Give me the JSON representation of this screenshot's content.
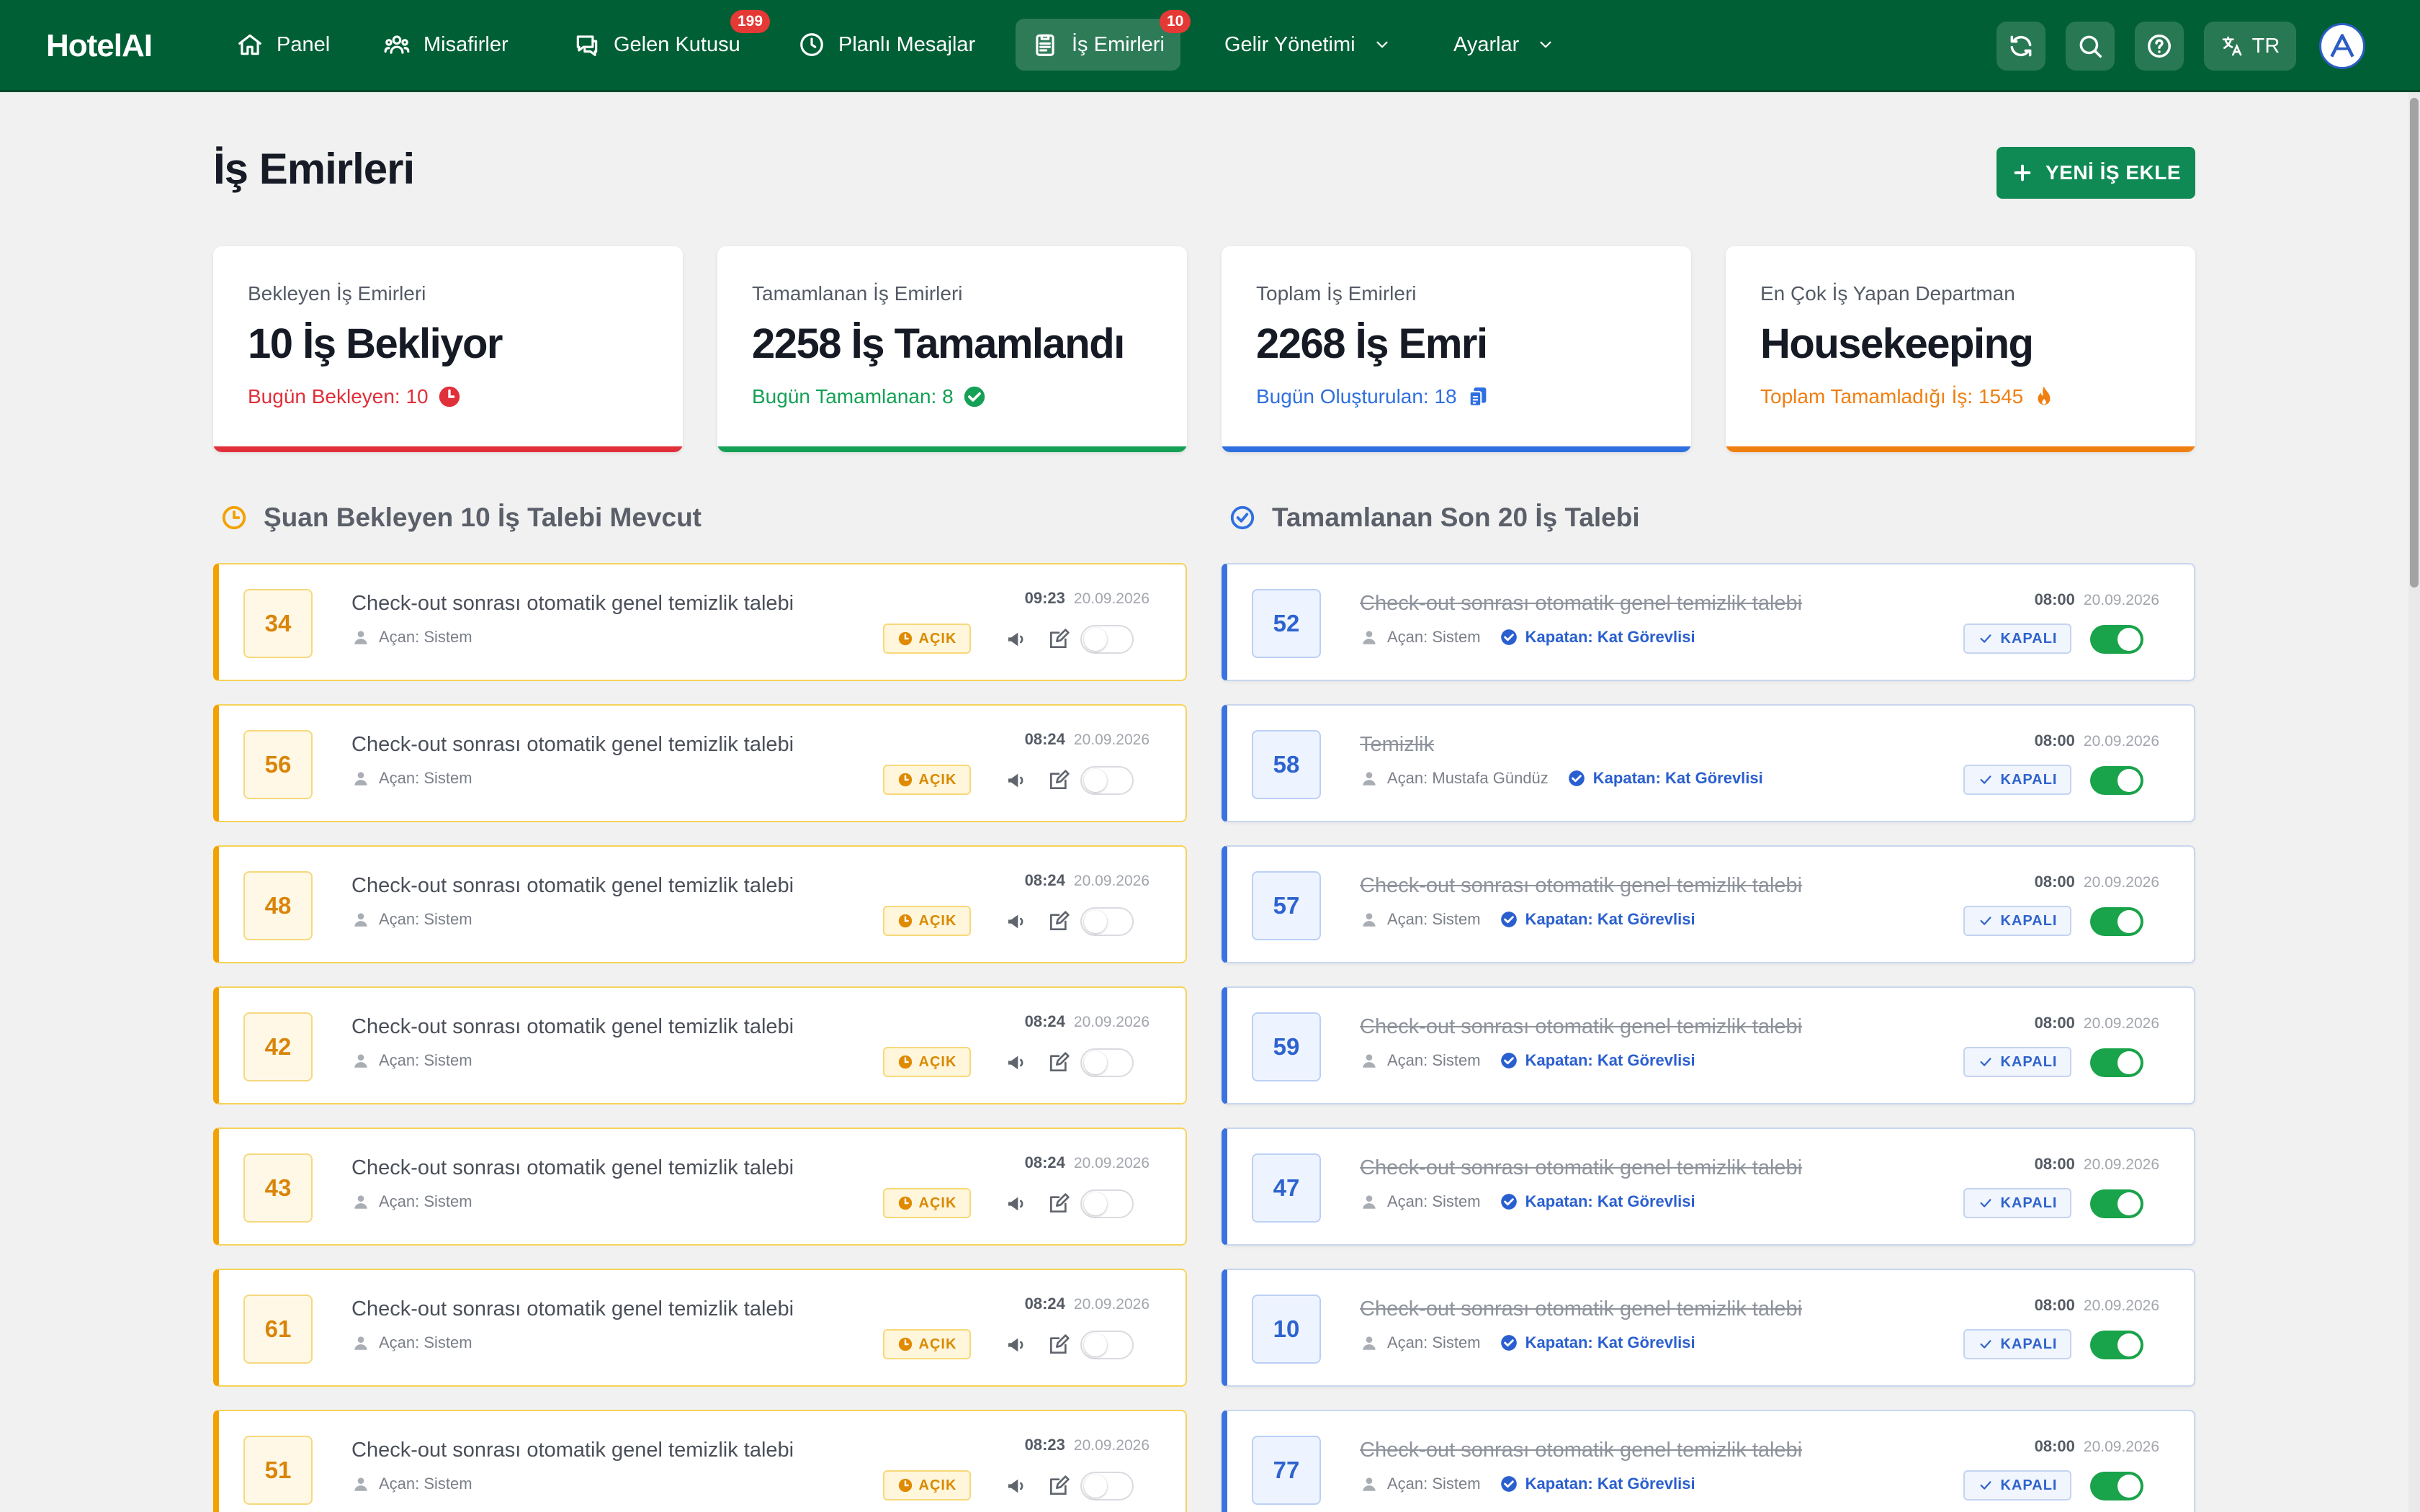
{
  "app": {
    "brand": "HotelAI"
  },
  "nav": {
    "items": [
      {
        "label": "Panel",
        "icon": "home-icon"
      },
      {
        "label": "Misafirler",
        "icon": "guests-icon"
      },
      {
        "label": "Gelen Kutusu",
        "icon": "chat-icon",
        "badge": "199"
      },
      {
        "label": "Planlı Mesajlar",
        "icon": "clock-icon"
      },
      {
        "label": "İş Emirleri",
        "icon": "clipboard-icon",
        "badge": "10",
        "active": true
      },
      {
        "label": "Gelir Yönetimi",
        "icon": "chevron-down-icon"
      },
      {
        "label": "Ayarlar",
        "icon": "chevron-down-icon"
      }
    ],
    "language": "TR"
  },
  "page": {
    "title": "İş Emirleri",
    "add_button": "YENİ İŞ EKLE"
  },
  "stats": [
    {
      "label": "Bekleyen İş Emirleri",
      "value": "10 İş Bekliyor",
      "sub": "Bugün Bekleyen: 10",
      "color": "#e0303a",
      "icon": "clock-icon"
    },
    {
      "label": "Tamamlanan İş Emirleri",
      "value": "2258 İş Tamamlandı",
      "sub": "Bugün Tamamlanan: 8",
      "color": "#14a155",
      "icon": "check-circle-icon"
    },
    {
      "label": "Toplam İş Emirleri",
      "value": "2268 İş Emri",
      "sub": "Bugün Oluşturulan: 18",
      "color": "#2f6fe0",
      "icon": "copy-icon"
    },
    {
      "label": "En Çok İş Yapan Departman",
      "value": "Housekeeping",
      "sub": "Toplam Tamamladığı İş: 1545",
      "color": "#f07f12",
      "icon": "fire-icon"
    }
  ],
  "pending": {
    "heading": "Şuan Bekleyen 10 İş Talebi Mevcut",
    "items": [
      {
        "id": "34",
        "title": "Check-out sonrası otomatik genel temizlik talebi",
        "opener": "Açan: Sistem",
        "time": "09:23",
        "date": "20.09.2026",
        "status": "AÇIK"
      },
      {
        "id": "56",
        "title": "Check-out sonrası otomatik genel temizlik talebi",
        "opener": "Açan: Sistem",
        "time": "08:24",
        "date": "20.09.2026",
        "status": "AÇIK"
      },
      {
        "id": "48",
        "title": "Check-out sonrası otomatik genel temizlik talebi",
        "opener": "Açan: Sistem",
        "time": "08:24",
        "date": "20.09.2026",
        "status": "AÇIK"
      },
      {
        "id": "42",
        "title": "Check-out sonrası otomatik genel temizlik talebi",
        "opener": "Açan: Sistem",
        "time": "08:24",
        "date": "20.09.2026",
        "status": "AÇIK"
      },
      {
        "id": "43",
        "title": "Check-out sonrası otomatik genel temizlik talebi",
        "opener": "Açan: Sistem",
        "time": "08:24",
        "date": "20.09.2026",
        "status": "AÇIK"
      },
      {
        "id": "61",
        "title": "Check-out sonrası otomatik genel temizlik talebi",
        "opener": "Açan: Sistem",
        "time": "08:24",
        "date": "20.09.2026",
        "status": "AÇIK"
      },
      {
        "id": "51",
        "title": "Check-out sonrası otomatik genel temizlik talebi",
        "opener": "Açan: Sistem",
        "time": "08:23",
        "date": "20.09.2026",
        "status": "AÇIK"
      }
    ]
  },
  "completed": {
    "heading": "Tamamlanan Son 20 İş Talebi",
    "items": [
      {
        "id": "52",
        "title": "Check-out sonrası otomatik genel temizlik talebi",
        "opener": "Açan: Sistem",
        "closer": "Kapatan: Kat Görevlisi",
        "time": "08:00",
        "date": "20.09.2026",
        "status": "KAPALI"
      },
      {
        "id": "58",
        "title": "Temizlik",
        "opener": "Açan: Mustafa Gündüz",
        "closer": "Kapatan: Kat Görevlisi",
        "time": "08:00",
        "date": "20.09.2026",
        "status": "KAPALI"
      },
      {
        "id": "57",
        "title": "Check-out sonrası otomatik genel temizlik talebi",
        "opener": "Açan: Sistem",
        "closer": "Kapatan: Kat Görevlisi",
        "time": "08:00",
        "date": "20.09.2026",
        "status": "KAPALI"
      },
      {
        "id": "59",
        "title": "Check-out sonrası otomatik genel temizlik talebi",
        "opener": "Açan: Sistem",
        "closer": "Kapatan: Kat Görevlisi",
        "time": "08:00",
        "date": "20.09.2026",
        "status": "KAPALI"
      },
      {
        "id": "47",
        "title": "Check-out sonrası otomatik genel temizlik talebi",
        "opener": "Açan: Sistem",
        "closer": "Kapatan: Kat Görevlisi",
        "time": "08:00",
        "date": "20.09.2026",
        "status": "KAPALI"
      },
      {
        "id": "10",
        "title": "Check-out sonrası otomatik genel temizlik talebi",
        "opener": "Açan: Sistem",
        "closer": "Kapatan: Kat Görevlisi",
        "time": "08:00",
        "date": "20.09.2026",
        "status": "KAPALI"
      },
      {
        "id": "77",
        "title": "Check-out sonrası otomatik genel temizlik talebi",
        "opener": "Açan: Sistem",
        "closer": "Kapatan: Kat Görevlisi",
        "time": "08:00",
        "date": "20.09.2026",
        "status": "KAPALI"
      }
    ]
  }
}
